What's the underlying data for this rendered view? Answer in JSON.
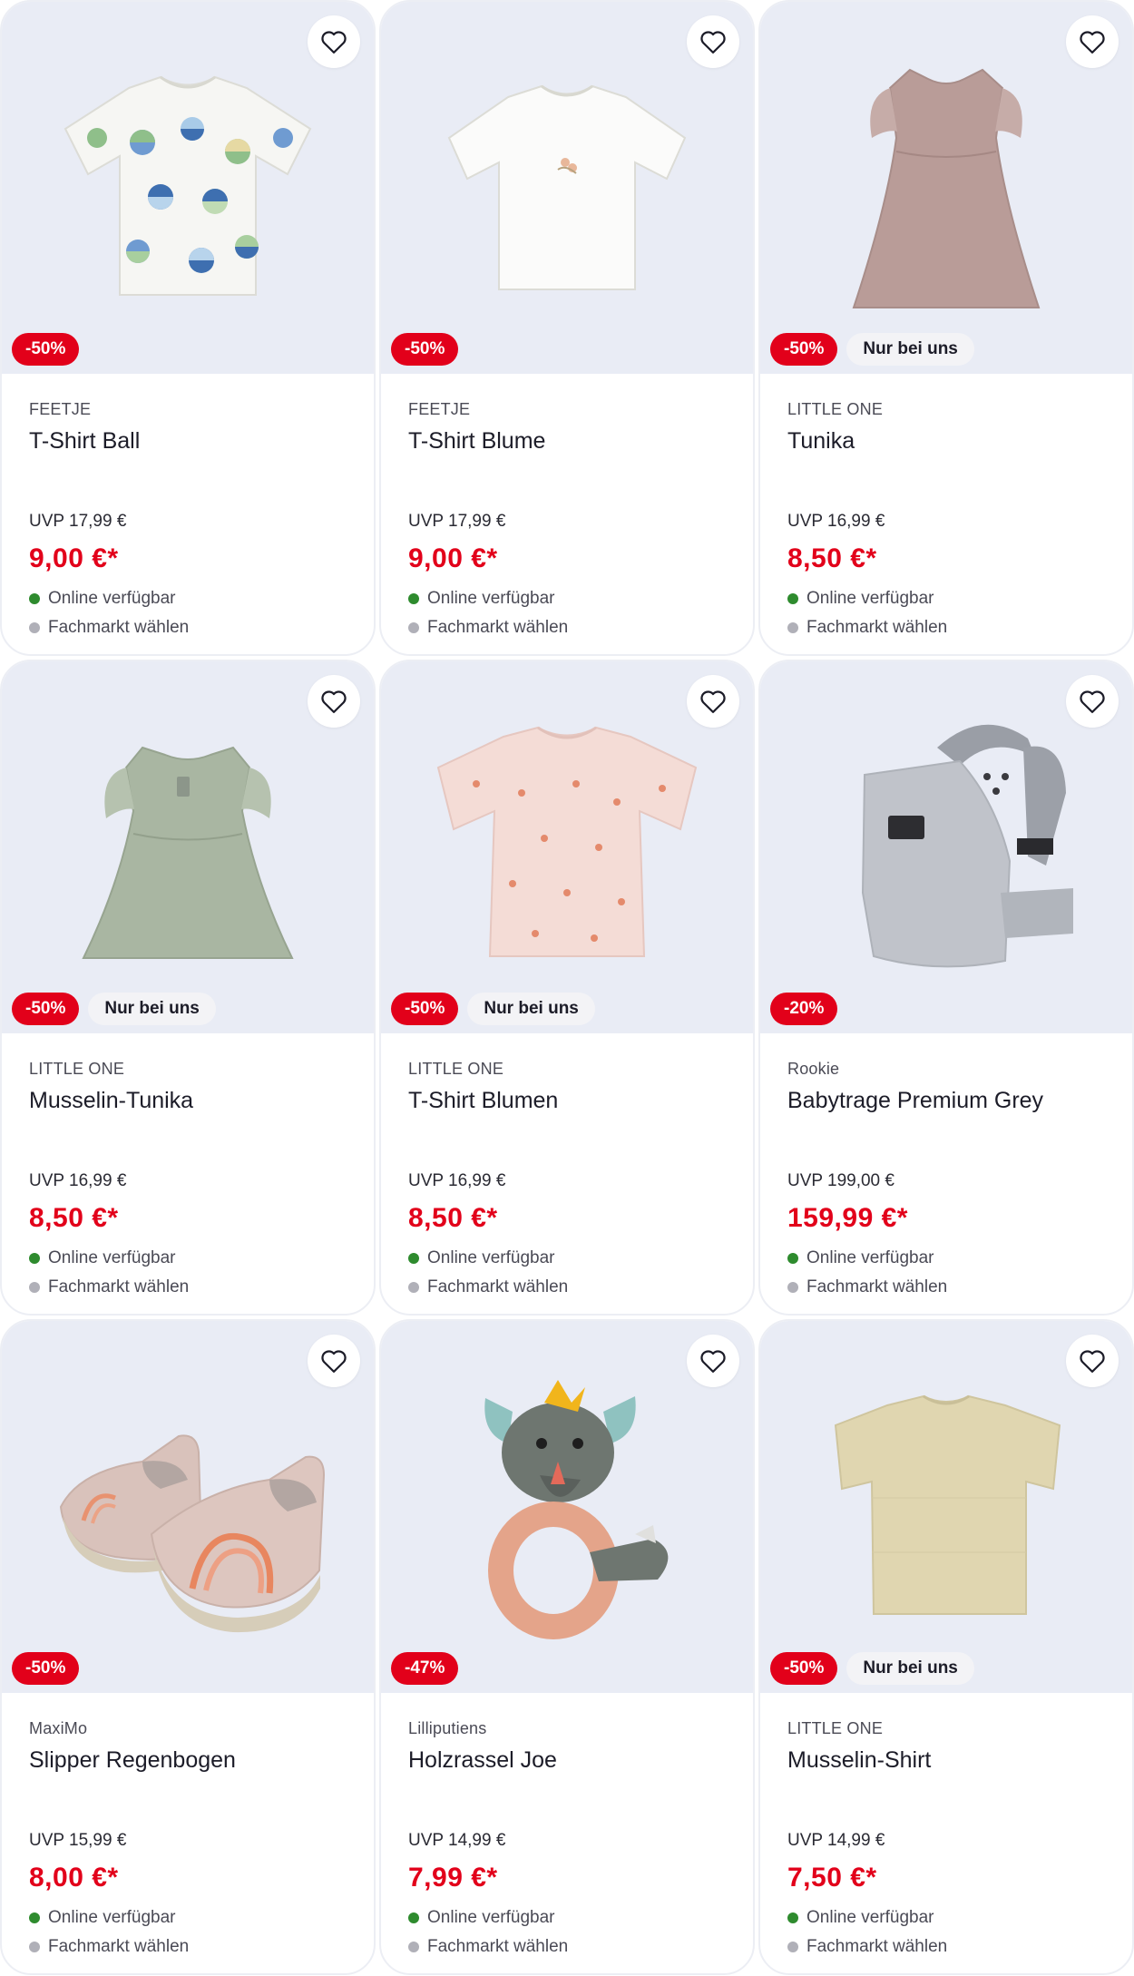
{
  "colors": {
    "sale_red": "#e2001a",
    "card_image_bg": "#e9ecf5",
    "online_green": "#2e8b2e",
    "store_grey": "#b0b0b8"
  },
  "icons": {
    "favorite": "heart-outline-icon",
    "online": "green-dot-icon",
    "store": "grey-dot-icon"
  },
  "products": [
    {
      "brand": "FEETJE",
      "name": "T-Shirt Ball",
      "discount": "-50%",
      "exclusive": "",
      "uvp": "UVP 17,99 €",
      "price": "9,00 €*",
      "online": "Online verfügbar",
      "store": "Fachmarkt wählen",
      "image": "t-shirt-beach-balls"
    },
    {
      "brand": "FEETJE",
      "name": "T-Shirt Blume",
      "discount": "-50%",
      "exclusive": "",
      "uvp": "UVP 17,99 €",
      "price": "9,00 €*",
      "online": "Online verfügbar",
      "store": "Fachmarkt wählen",
      "image": "t-shirt-white-flower"
    },
    {
      "brand": "LITTLE ONE",
      "name": "Tunika",
      "discount": "-50%",
      "exclusive": "Nur bei uns",
      "uvp": "UVP 16,99 €",
      "price": "8,50 €*",
      "online": "Online verfügbar",
      "store": "Fachmarkt wählen",
      "image": "tunic-mauve"
    },
    {
      "brand": "LITTLE ONE",
      "name": "Musselin-Tunika",
      "discount": "-50%",
      "exclusive": "Nur bei uns",
      "uvp": "UVP 16,99 €",
      "price": "8,50 €*",
      "online": "Online verfügbar",
      "store": "Fachmarkt wählen",
      "image": "tunic-sage"
    },
    {
      "brand": "LITTLE ONE",
      "name": "T-Shirt Blumen",
      "discount": "-50%",
      "exclusive": "Nur bei uns",
      "uvp": "UVP 16,99 €",
      "price": "8,50 €*",
      "online": "Online verfügbar",
      "store": "Fachmarkt wählen",
      "image": "t-shirt-pink-flowers"
    },
    {
      "brand": "Rookie",
      "name": "Babytrage Premium Grey",
      "discount": "-20%",
      "exclusive": "",
      "uvp": "UVP 199,00 €",
      "price": "159,99 €*",
      "online": "Online verfügbar",
      "store": "Fachmarkt wählen",
      "image": "baby-carrier-grey"
    },
    {
      "brand": "MaxiMo",
      "name": "Slipper Regenbogen",
      "discount": "-50%",
      "exclusive": "",
      "uvp": "UVP 15,99 €",
      "price": "8,00 €*",
      "online": "Online verfügbar",
      "store": "Fachmarkt wählen",
      "image": "slippers-rainbow"
    },
    {
      "brand": "Lilliputiens",
      "name": "Holzrassel Joe",
      "discount": "-47%",
      "exclusive": "",
      "uvp": "UVP 14,99 €",
      "price": "7,99 €*",
      "online": "Online verfügbar",
      "store": "Fachmarkt wählen",
      "image": "wooden-rattle-rhino"
    },
    {
      "brand": "LITTLE ONE",
      "name": "Musselin-Shirt",
      "discount": "-50%",
      "exclusive": "Nur bei uns",
      "uvp": "UVP 14,99 €",
      "price": "7,50 €*",
      "online": "Online verfügbar",
      "store": "Fachmarkt wählen",
      "image": "muslin-shirt-beige"
    }
  ]
}
